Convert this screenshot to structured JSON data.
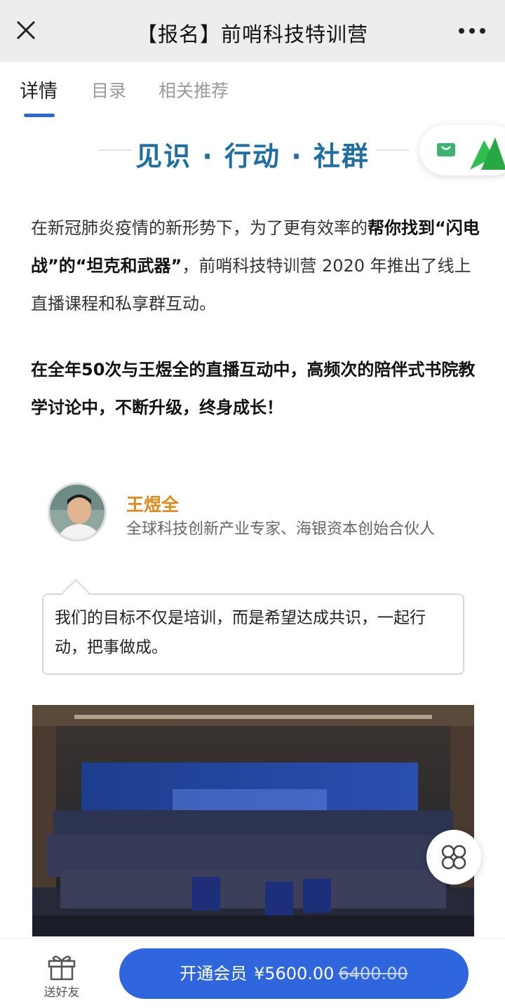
{
  "topbar": {
    "title": "【报名】前哨科技特训营",
    "close_icon": "close-icon",
    "more_icon": "more-dots-icon"
  },
  "tabs": [
    {
      "label": "详情",
      "active": true
    },
    {
      "label": "目录",
      "active": false
    },
    {
      "label": "相关推荐",
      "active": false
    }
  ],
  "section": {
    "heading": "见识 · 行动 · 社群"
  },
  "intro": {
    "p1_part1": "在新冠肺炎疫情的新形势下，为了更有效率的",
    "p1_bold": "帮你找到“闪电战”的“坦克和武器”",
    "p1_part2": "，前哨科技特训营 2020 年推出了线上直播课程和私享群互动。",
    "p2": "在全年50次与王煜全的直播互动中，高频次的陪伴式书院教学讨论中，不断升级，终身成长！"
  },
  "profile": {
    "name": "王煜全",
    "description": "全球科技创新产业专家、海银资本创始合伙人",
    "quote": "我们的目标不仅是培训，而是希望达成共识，一起行动，把事做成。"
  },
  "bottom": {
    "gift_label": "送好友",
    "join_label": "开通会员",
    "price": "¥5600.00",
    "original_price": "6400.00"
  },
  "colors": {
    "accent": "#2f66dd",
    "heading": "#1f6fa3",
    "name": "#e08a1c"
  }
}
